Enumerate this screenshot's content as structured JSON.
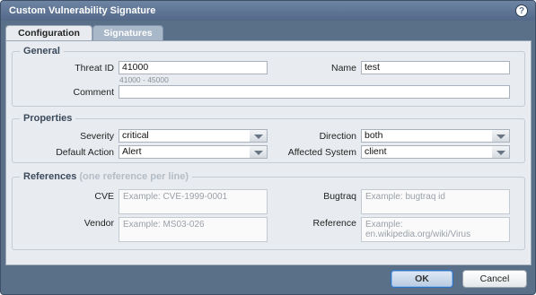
{
  "window": {
    "title": "Custom Vulnerability Signature",
    "help_icon": "?"
  },
  "tabs": [
    {
      "label": "Configuration",
      "active": true
    },
    {
      "label": "Signatures",
      "active": false
    }
  ],
  "general": {
    "legend": "General",
    "threat_id_label": "Threat ID",
    "threat_id_value": "41000",
    "threat_id_range": "41000 - 45000",
    "name_label": "Name",
    "name_value": "test",
    "comment_label": "Comment",
    "comment_value": ""
  },
  "properties": {
    "legend": "Properties",
    "severity_label": "Severity",
    "severity_value": "critical",
    "direction_label": "Direction",
    "direction_value": "both",
    "default_action_label": "Default Action",
    "default_action_value": "Alert",
    "affected_system_label": "Affected System",
    "affected_system_value": "client"
  },
  "references": {
    "legend": "References",
    "legend_hint": "(one reference per line)",
    "cve_label": "CVE",
    "cve_placeholder": "Example: CVE-1999-0001",
    "bugtraq_label": "Bugtraq",
    "bugtraq_placeholder": "Example: bugtraq id",
    "vendor_label": "Vendor",
    "vendor_placeholder": "Example: MS03-026",
    "reference_label": "Reference",
    "reference_placeholder": "Example: en.wikipedia.org/wiki/Virus"
  },
  "buttons": {
    "ok": "OK",
    "cancel": "Cancel"
  },
  "colors": {
    "titlebar": "#5a6f88",
    "accent_ok": "#2f73c4"
  }
}
